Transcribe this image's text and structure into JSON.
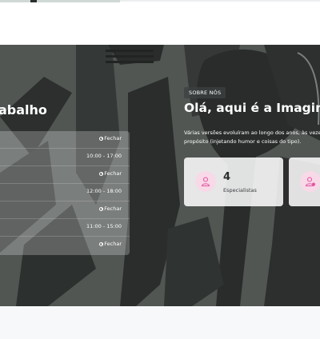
{
  "work_section": {
    "title": "abalho",
    "schedule": [
      {
        "value": "Fechar",
        "closed": true
      },
      {
        "value": "10:00 - 17:00",
        "closed": false
      },
      {
        "value": "Fechar",
        "closed": true
      },
      {
        "value": "12:00 - 18:00",
        "closed": false
      },
      {
        "value": "Fechar",
        "closed": true
      },
      {
        "value": "11:00 - 15:00",
        "closed": false
      },
      {
        "value": "Fechar",
        "closed": true
      }
    ]
  },
  "about": {
    "badge": "SOBRE NÓS",
    "title": "Olá, aqui é a Imagine Be",
    "text": "Várias versões evoluíram ao longo dos anos, às vezes de propósito (injetando humor e coisas do tipo).",
    "stats": [
      {
        "number": "4",
        "label": "Especialistas",
        "icon": "person-icon"
      },
      {
        "number": "",
        "label": "",
        "icon": "person-check-icon"
      }
    ]
  },
  "colors": {
    "accent_pink": "#e455a0",
    "icon_bg": "#f8d9e8",
    "hero_bg": "#5d625e"
  }
}
